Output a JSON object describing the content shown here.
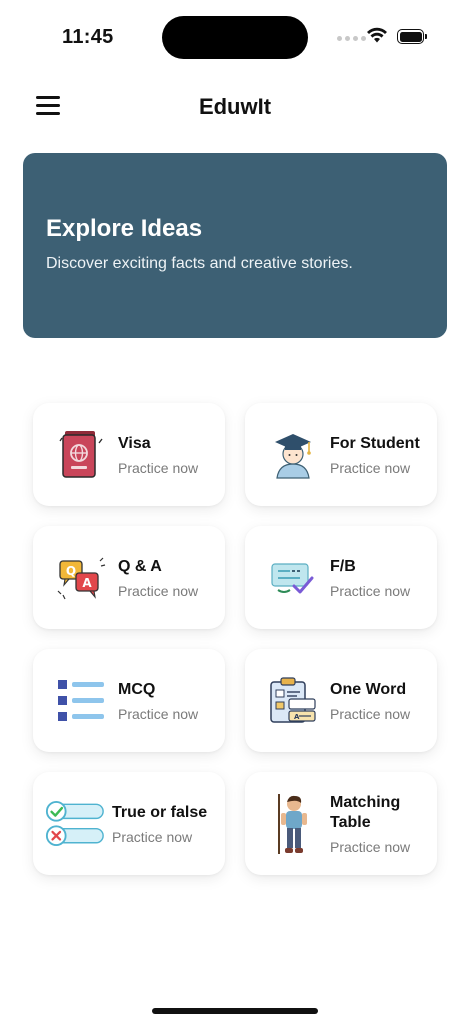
{
  "status_bar": {
    "time": "11:45"
  },
  "header": {
    "title": "EduwIt",
    "menu_icon": "hamburger-menu-icon"
  },
  "banner": {
    "title": "Explore Ideas",
    "subtitle": "Discover exciting facts and creative stories.",
    "background_color": "#3d6074"
  },
  "cards": [
    {
      "title": "Visa",
      "subtitle": "Practice now",
      "icon": "passport-icon"
    },
    {
      "title": "For Student",
      "subtitle": "Practice now",
      "icon": "graduate-student-icon"
    },
    {
      "title": "Q & A",
      "subtitle": "Practice now",
      "icon": "question-answer-icon"
    },
    {
      "title": "F/B",
      "subtitle": "Practice now",
      "icon": "fill-blank-icon"
    },
    {
      "title": "MCQ",
      "subtitle": "Practice now",
      "icon": "list-icon"
    },
    {
      "title": "One Word",
      "subtitle": "Practice now",
      "icon": "clipboard-form-icon"
    },
    {
      "title": "True or false",
      "subtitle": "Practice now",
      "icon": "true-false-icon"
    },
    {
      "title": "Matching Table",
      "subtitle": "Practice now",
      "icon": "character-with-stick-icon"
    }
  ]
}
